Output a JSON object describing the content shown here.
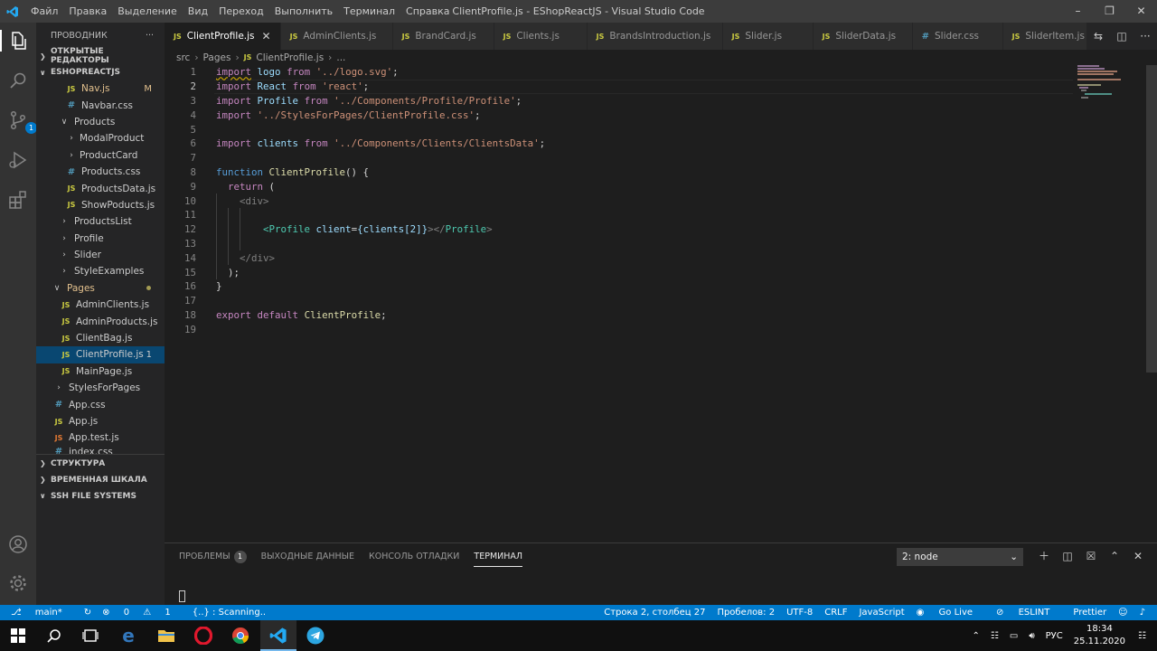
{
  "window": {
    "title": "ClientProfile.js - EShopReactJS - Visual Studio Code",
    "menu": [
      "Файл",
      "Правка",
      "Выделение",
      "Вид",
      "Переход",
      "Выполнить",
      "Терминал",
      "Справка"
    ]
  },
  "sidebar": {
    "header": "ПРОВОДНИК",
    "more": "···",
    "sections": {
      "open_editors": "ОТКРЫТЫЕ РЕДАКТОРЫ",
      "project": "ESHOPREACTJS",
      "outline": "СТРУКТУРА",
      "timeline": "ВРЕМЕННАЯ ШКАЛА",
      "ssh": "SSH FILE SYSTEMS"
    },
    "tree": [
      {
        "label": "Nav.js",
        "badge": "M"
      },
      {
        "label": "Navbar.css"
      },
      {
        "label": "Products"
      },
      {
        "label": "ModalProduct"
      },
      {
        "label": "ProductCard"
      },
      {
        "label": "Products.css"
      },
      {
        "label": "ProductsData.js"
      },
      {
        "label": "ShowPoducts.js"
      },
      {
        "label": "ProductsList"
      },
      {
        "label": "Profile"
      },
      {
        "label": "Slider"
      },
      {
        "label": "StyleExamples"
      },
      {
        "label": "Pages"
      },
      {
        "label": "AdminClients.js"
      },
      {
        "label": "AdminProducts.js"
      },
      {
        "label": "ClientBag.js"
      },
      {
        "label": "ClientProfile.js",
        "badge": "1"
      },
      {
        "label": "MainPage.js"
      },
      {
        "label": "StylesForPages"
      },
      {
        "label": "App.css"
      },
      {
        "label": "App.js"
      },
      {
        "label": "App.test.js"
      },
      {
        "label": "index.css"
      }
    ]
  },
  "tabs": [
    {
      "label": "ClientProfile.js",
      "type": "js"
    },
    {
      "label": "AdminClients.js",
      "type": "js"
    },
    {
      "label": "BrandCard.js",
      "type": "js"
    },
    {
      "label": "Clients.js",
      "type": "js"
    },
    {
      "label": "BrandsIntroduction.js",
      "type": "js"
    },
    {
      "label": "Slider.js",
      "type": "js"
    },
    {
      "label": "SliderData.js",
      "type": "js"
    },
    {
      "label": "Slider.css",
      "type": "css"
    },
    {
      "label": "SliderItem.js",
      "type": "js"
    }
  ],
  "breadcrumb": [
    "src",
    "Pages",
    "ClientProfile.js",
    "..."
  ],
  "editor": {
    "line_numbers": [
      "1",
      "2",
      "3",
      "4",
      "5",
      "6",
      "7",
      "8",
      "9",
      "10",
      "11",
      "12",
      "13",
      "14",
      "15",
      "16",
      "17",
      "18",
      "19"
    ],
    "tokens": {
      "import": "import",
      "from": "from",
      "logo": "logo",
      "logo_path": "'../logo.svg'",
      "react": "React",
      "react_path": "'react'",
      "profile": "Profile",
      "profile_path": "'../Components/Profile/Profile'",
      "css_path": "'../StylesForPages/ClientProfile.css'",
      "clients": "clients",
      "clients_path": "'../Components/Clients/ClientsData'",
      "semicolon": ";",
      "function": "function",
      "fn_name": "ClientProfile",
      "fn_sig": "() {",
      "return": "return",
      "paren_open": "(",
      "div_open": "<div>",
      "profile_open": "<Profile",
      "client_attr": "client",
      "attr_eq": "=",
      "attr_value": "{clients[2]}",
      "self_close": "></",
      "profile_close_tag": "Profile",
      "gt": ">",
      "div_close": "</div>",
      "paren_close": ");",
      "brace_close": "}",
      "export": "export",
      "default": "default"
    }
  },
  "panel": {
    "tabs": [
      "ПРОБЛЕМЫ",
      "ВЫХОДНЫЕ ДАННЫЕ",
      "КОНСОЛЬ ОТЛАДКИ",
      "ТЕРМИНАЛ"
    ],
    "problems_count": "1",
    "terminal_select": "2: node"
  },
  "statusbar": {
    "branch": "main*",
    "errors": "0",
    "warnings": "1",
    "scanning": "{..} : Scanning..",
    "position": "Строка 2, столбец 27",
    "spaces": "Пробелов: 2",
    "encoding": "UTF-8",
    "eol": "CRLF",
    "language": "JavaScript",
    "golive": "Go Live",
    "eslint": "ESLINT",
    "prettier": "Prettier"
  },
  "taskbar": {
    "lang": "РУС",
    "time": "18:34",
    "date": "25.11.2020"
  },
  "colors": {
    "accent": "#007acc",
    "selection": "#094771"
  }
}
